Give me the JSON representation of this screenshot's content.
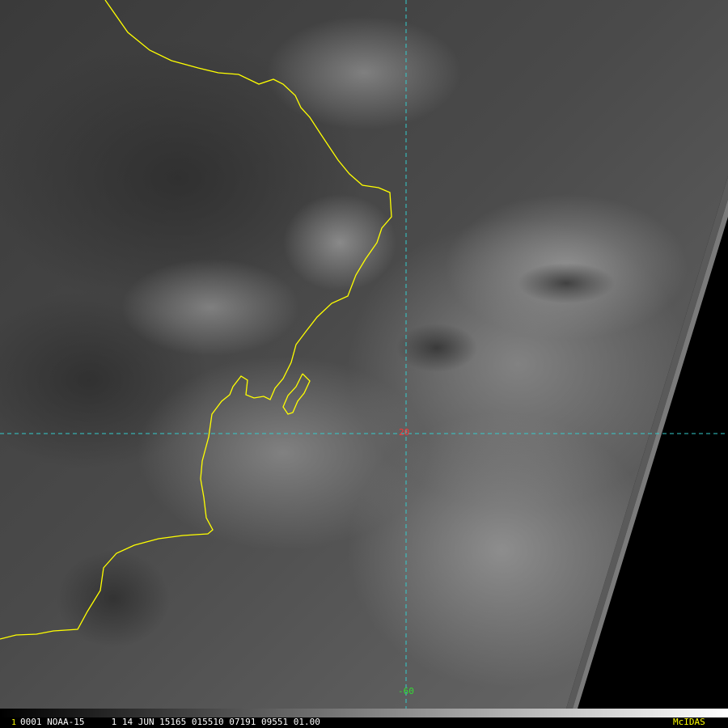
{
  "grid": {
    "latitude_label": "20",
    "longitude_label": "-60",
    "grid_color": "#33cccc",
    "latitude_label_color": "#ff3333",
    "longitude_label_color": "#33dd33"
  },
  "coastline": {
    "color": "#ffff00"
  },
  "status_bar": {
    "frame_number": "1",
    "frame_number_color": "#ffff00",
    "text": "0001 NOAA-15     1 14 JUN 15165 015510 07191 09551 01.00",
    "logo": "McIDAS",
    "logo_color": "#ffff00"
  }
}
